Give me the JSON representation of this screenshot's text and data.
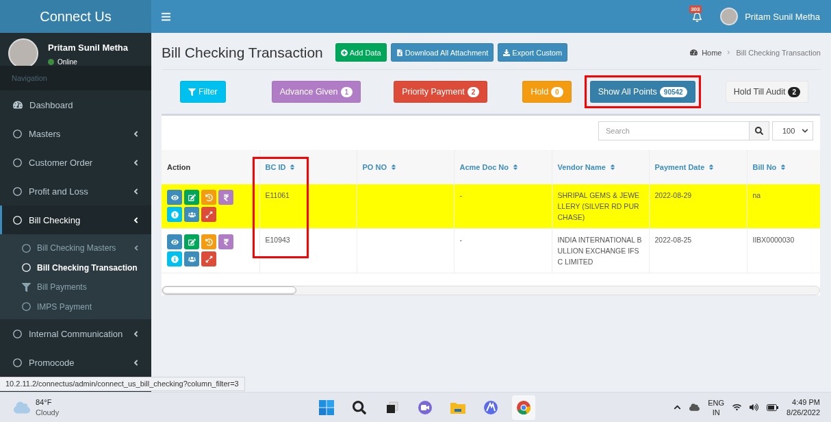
{
  "app": {
    "brand": "Connect Us"
  },
  "header": {
    "notifications": "303",
    "user_name": "Pritam Sunil Metha"
  },
  "sidebar": {
    "user": {
      "name": "Pritam Sunil Metha",
      "status": "Online"
    },
    "section_label": "Navigation",
    "items": [
      {
        "label": "Dashboard",
        "kind": "home",
        "selected": false
      },
      {
        "label": "Masters",
        "kind": "group",
        "selected": false
      },
      {
        "label": "Customer Order",
        "kind": "group",
        "selected": false
      },
      {
        "label": "Profit and Loss",
        "kind": "group",
        "selected": false
      },
      {
        "label": "Bill Checking",
        "kind": "group",
        "selected": true,
        "expanded": true,
        "children": [
          {
            "label": "Bill Checking Masters",
            "kind": "group",
            "selected": false
          },
          {
            "label": "Bill Checking Transaction",
            "kind": "page",
            "selected": true
          },
          {
            "label": "Bill Payments",
            "kind": "payments",
            "selected": false
          },
          {
            "label": "IMPS Payment",
            "kind": "page",
            "selected": false
          }
        ]
      },
      {
        "label": "Internal Communication",
        "kind": "group",
        "selected": false
      },
      {
        "label": "Promocode",
        "kind": "group",
        "selected": false
      }
    ]
  },
  "page": {
    "title": "Bill Checking Transaction",
    "actions": [
      {
        "label": "Add Data",
        "kind": "add"
      },
      {
        "label": "Download All Attachment",
        "kind": "download"
      },
      {
        "label": "Export Custom",
        "kind": "export"
      }
    ],
    "breadcrumb": [
      "Home",
      "Bill Checking Transaction"
    ]
  },
  "filters": [
    {
      "label": "Filter",
      "kind": "info",
      "highlighted": false
    },
    {
      "label": "Advance Given",
      "count": "1",
      "kind": "purple",
      "highlighted": false
    },
    {
      "label": "Priority Payment",
      "count": "2",
      "kind": "danger",
      "highlighted": false
    },
    {
      "label": "Hold",
      "count": "0",
      "kind": "warning",
      "highlighted": false
    },
    {
      "label": "Show All Points",
      "count": "90542",
      "kind": "primary",
      "highlighted": true
    },
    {
      "label": "Hold Till Audit",
      "count": "2",
      "kind": "default",
      "highlighted": false
    }
  ],
  "table": {
    "search": {
      "placeholder": "Search"
    },
    "page_size": "100",
    "columns": [
      {
        "label": "Action",
        "sortable": false,
        "highlighted": false
      },
      {
        "label": "BC ID",
        "sortable": true,
        "highlighted": true
      },
      {
        "label": "PO NO",
        "sortable": true,
        "highlighted": false
      },
      {
        "label": "Acme Doc No",
        "sortable": true,
        "highlighted": false
      },
      {
        "label": "Vendor Name",
        "sortable": true,
        "highlighted": false
      },
      {
        "label": "Payment Date",
        "sortable": true,
        "highlighted": false
      },
      {
        "label": "Bill No",
        "sortable": true,
        "highlighted": false
      }
    ],
    "rows": [
      {
        "highlighted": true,
        "actions": [
          {
            "kind": "view"
          },
          {
            "kind": "edit"
          },
          {
            "kind": "history"
          },
          {
            "kind": "payment"
          },
          {
            "kind": "info"
          },
          {
            "kind": "team"
          },
          {
            "kind": "expand"
          }
        ],
        "cells": [
          "",
          "E11061",
          "",
          "-",
          "SHRIPAL GEMS & JEWELLERY (SILVER RD PURCHASE)",
          "2022-08-29",
          "na"
        ]
      },
      {
        "highlighted": false,
        "actions": [
          {
            "kind": "view"
          },
          {
            "kind": "edit"
          },
          {
            "kind": "history"
          },
          {
            "kind": "payment"
          },
          {
            "kind": "info"
          },
          {
            "kind": "team"
          },
          {
            "kind": "expand"
          }
        ],
        "cells": [
          "",
          "E10943",
          "",
          "-",
          "INDIA INTERNATIONAL BULLION EXCHANGE IFSC LIMITED",
          "2022-08-25",
          "IIBX0000030"
        ]
      }
    ]
  },
  "status_url": "10.2.11.2/connectus/admin/connect_us_bill_checking?column_filter=3",
  "taskbar": {
    "weather": {
      "temperature": "84°F",
      "condition": "Cloudy"
    },
    "language": [
      "ENG",
      "IN"
    ],
    "time": "4:49 PM",
    "date": "8/26/2022"
  }
}
